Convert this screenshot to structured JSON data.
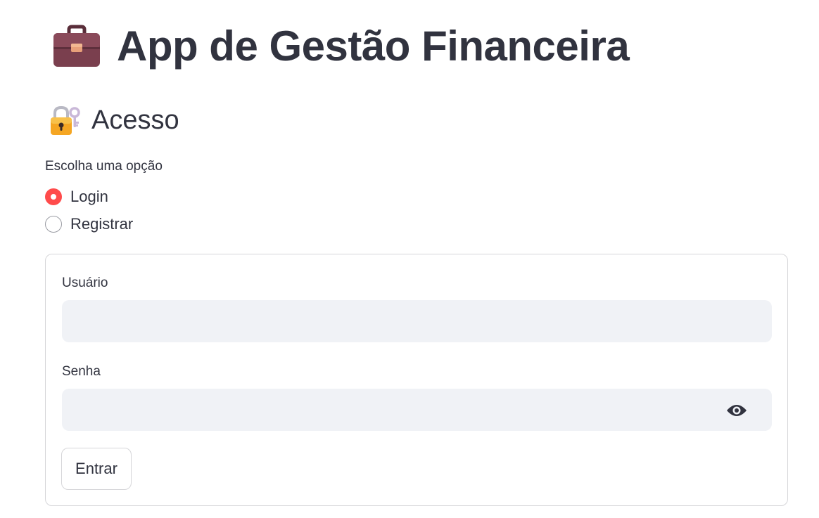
{
  "header": {
    "icon": "briefcase-icon",
    "title": "App de Gestão Financeira"
  },
  "access": {
    "icon": "locked-with-key-icon",
    "subtitle": "Acesso"
  },
  "auth_mode": {
    "label": "Escolha uma opção",
    "options": [
      "Login",
      "Registrar"
    ],
    "selected": "Login"
  },
  "login_form": {
    "username_label": "Usuário",
    "username_value": "",
    "password_label": "Senha",
    "password_value": "",
    "password_toggle_icon": "eye-icon",
    "submit_label": "Entrar"
  },
  "colors": {
    "accent": "#ff4b4b",
    "text": "#31333f",
    "input_bg": "#f0f2f6",
    "border": "#d6d6d9"
  }
}
